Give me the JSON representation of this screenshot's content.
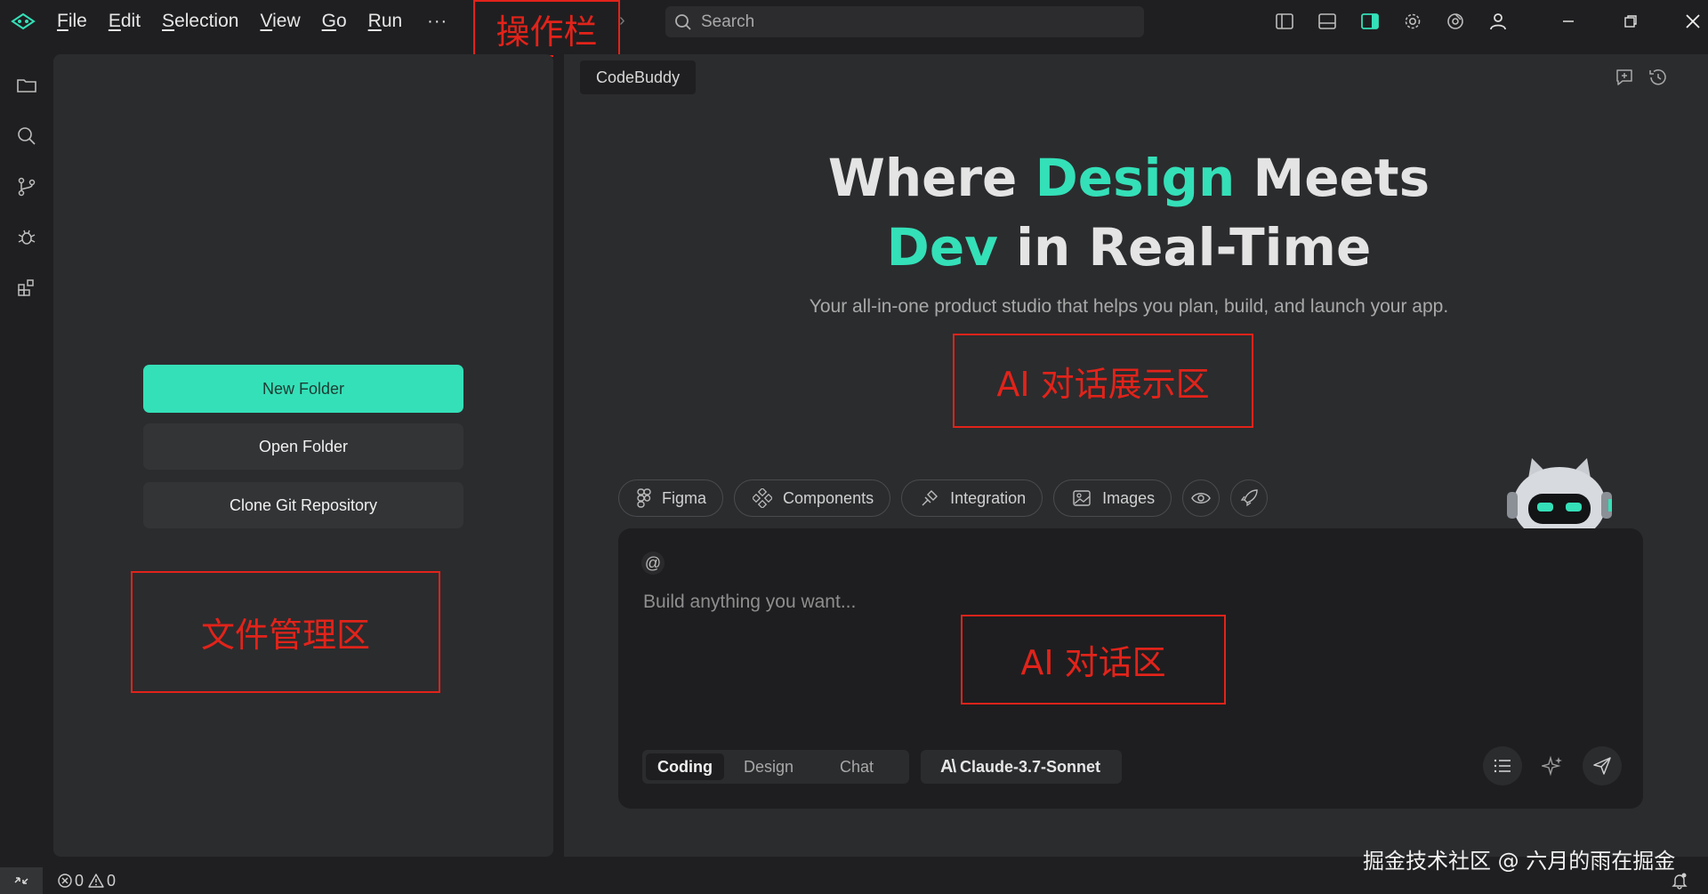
{
  "titlebar": {
    "menu": [
      {
        "key": "F",
        "rest": "ile"
      },
      {
        "key": "E",
        "rest": "dit"
      },
      {
        "key": "S",
        "rest": "election"
      },
      {
        "key": "V",
        "rest": "iew"
      },
      {
        "key": "G",
        "rest": "o"
      },
      {
        "key": "R",
        "rest": "un"
      }
    ],
    "more": "···",
    "search_placeholder": "Search",
    "annotation_toolbar": "操作栏"
  },
  "explorer": {
    "new_folder": "New Folder",
    "open_folder": "Open Folder",
    "clone_repo": "Clone Git Repository",
    "annotation_files": "文件管理区"
  },
  "ai_panel": {
    "tab_label": "CodeBuddy",
    "hero": {
      "line1_a": "Where ",
      "line1_accent": "Design",
      "line1_b": " Meets",
      "line2_accent": "Dev",
      "line2_b": " in Real-Time"
    },
    "subtitle": "Your all-in-one product studio that helps you plan, build, and launch your app.",
    "annotation_display": "AI 对话展示区",
    "chips": [
      "Figma",
      "Components",
      "Integration",
      "Images"
    ],
    "composer": {
      "at": "@",
      "placeholder": "Build anything you want...",
      "annotation_chat": "AI 对话区",
      "modes": [
        "Coding",
        "Design",
        "Chat"
      ],
      "model_mark": "A\\",
      "model": "Claude-3.7-Sonnet"
    }
  },
  "statusbar": {
    "errors": "0",
    "warnings": "0",
    "watermark": "掘金技术社区 @ 六月的雨在掘金"
  },
  "colors": {
    "accent": "#34e0b8",
    "annotation": "#e2231a",
    "panel": "#2b2c2e",
    "background": "#1f1f21"
  }
}
